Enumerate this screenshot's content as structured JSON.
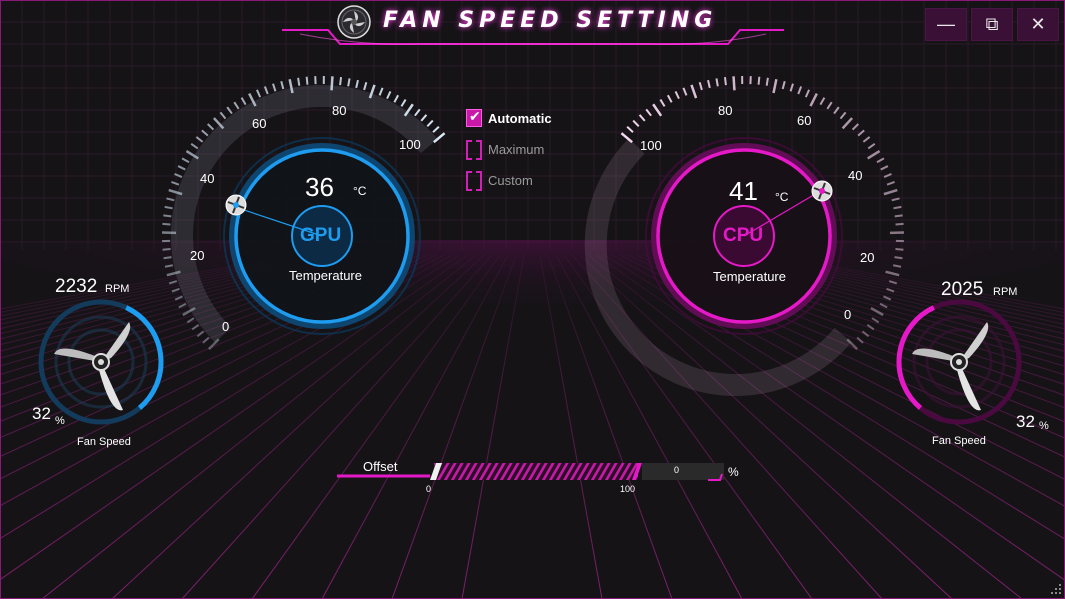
{
  "window": {
    "title": "FAN SPEED SETTING",
    "controls": {
      "minimize": "—",
      "maximize": "⧉",
      "close": "✕"
    }
  },
  "gpu": {
    "label": "GPU",
    "temperature": "36",
    "temp_unit": "°C",
    "temp_caption": "Temperature",
    "gauge_ticks": [
      "0",
      "20",
      "40",
      "60",
      "80",
      "100"
    ],
    "fan_rpm": "2232",
    "rpm_unit": "RPM",
    "fan_percent": "32",
    "percent_unit": "%",
    "fan_caption": "Fan Speed",
    "fan_level": 0.32,
    "accent": "#1e9cf0"
  },
  "cpu": {
    "label": "CPU",
    "temperature": "41",
    "temp_unit": "°C",
    "temp_caption": "Temperature",
    "gauge_ticks": [
      "0",
      "20",
      "40",
      "60",
      "80",
      "100"
    ],
    "fan_rpm": "2025",
    "rpm_unit": "RPM",
    "fan_percent": "32",
    "percent_unit": "%",
    "fan_caption": "Fan Speed",
    "fan_level": 0.32,
    "accent": "#e619c8"
  },
  "mode": {
    "options": [
      {
        "label": "Automatic",
        "checked": true
      },
      {
        "label": "Maximum",
        "checked": false
      },
      {
        "label": "Custom",
        "checked": false
      }
    ]
  },
  "offset": {
    "label": "Offset",
    "min_label": "0",
    "max_label": "100",
    "value": "0",
    "unit": "%"
  }
}
